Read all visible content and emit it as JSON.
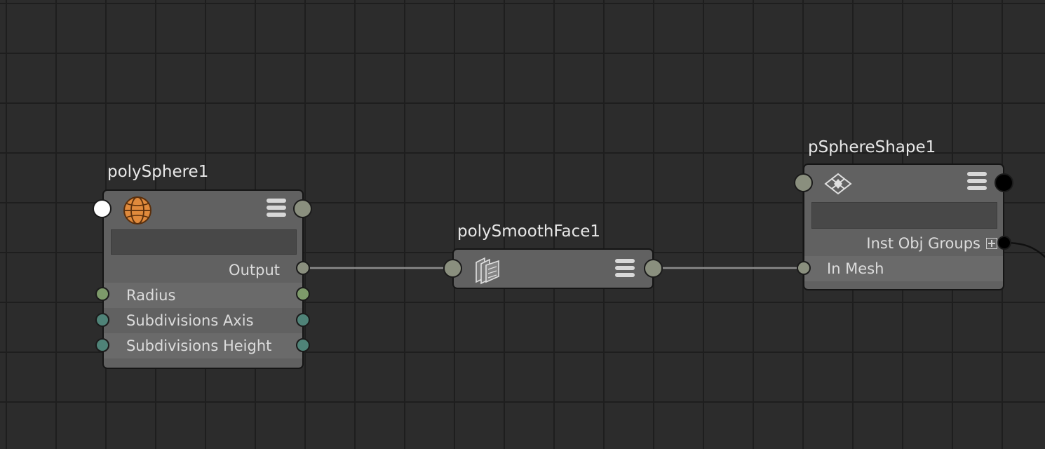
{
  "nodes": {
    "poly_sphere": {
      "title": "polySphere1",
      "output_label": "Output",
      "attributes": [
        "Radius",
        "Subdivisions Axis",
        "Subdivisions Height"
      ],
      "icon": "sphere-icon"
    },
    "poly_smooth_face": {
      "title": "polySmoothFace1",
      "icon": "smooth-face-icon"
    },
    "p_sphere_shape": {
      "title": "pSphereShape1",
      "inst_obj_groups_label": "Inst Obj Groups",
      "in_mesh_label": "In Mesh",
      "icon": "mesh-shape-icon"
    }
  },
  "colors": {
    "grid_background": "#2c2c2c",
    "grid_line": "#1e1e1e",
    "node_body": "#616161",
    "sphere_icon": "#e08a3c",
    "port_output": "#8a8f7e",
    "port_radius": "#7d9a6a",
    "port_subdivisions": "#4f8378",
    "wire": "#8c8c8c"
  }
}
